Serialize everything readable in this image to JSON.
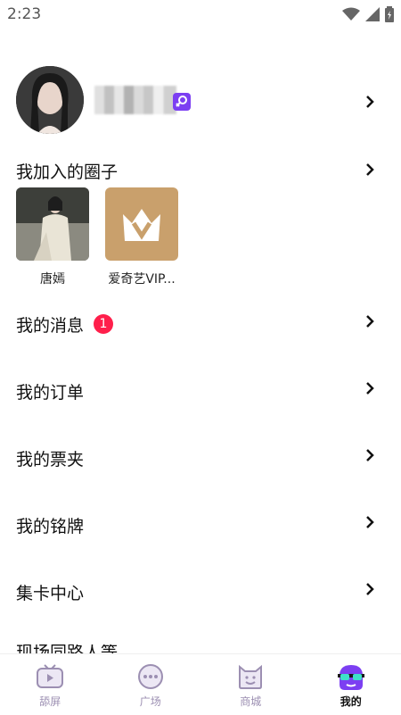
{
  "status_bar": {
    "time": "2:23"
  },
  "colors": {
    "accent": "#7c3ff2",
    "badge_red": "#ff1f4b",
    "nav_inactive": "#9c8fb2"
  },
  "profile": {
    "gender_icon": "female-icon"
  },
  "circles_section": {
    "title": "我加入的圈子",
    "items": [
      {
        "name": "唐嫣"
      },
      {
        "name": "爱奇艺VIP..."
      }
    ]
  },
  "menu": {
    "messages": {
      "label": "我的消息",
      "count": "1"
    },
    "orders": {
      "label": "我的订单"
    },
    "tickets": {
      "label": "我的票夹"
    },
    "badges": {
      "label": "我的铭牌"
    },
    "cards": {
      "label": "集卡中心"
    },
    "partial": {
      "label": "现场同路人等"
    }
  },
  "bottom_nav": {
    "items": [
      {
        "label": "舔屏",
        "icon": "tv-icon"
      },
      {
        "label": "广场",
        "icon": "chat-bubble-icon"
      },
      {
        "label": "商城",
        "icon": "smile-bag-icon"
      },
      {
        "label": "我的",
        "icon": "avatar-glasses-icon"
      }
    ]
  }
}
